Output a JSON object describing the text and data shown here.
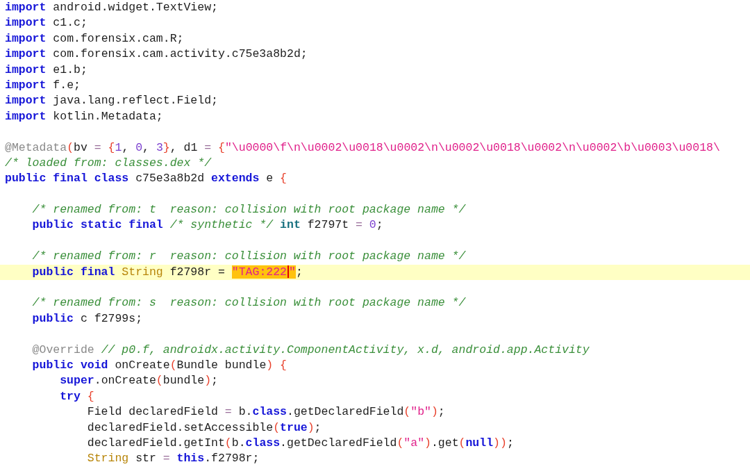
{
  "code_lines": [
    {
      "highlighted": false,
      "tokens": [
        {
          "kind": "keyword",
          "text": "import"
        },
        {
          "kind": "plain",
          "text": " android.widget.TextView;"
        }
      ]
    },
    {
      "highlighted": false,
      "tokens": [
        {
          "kind": "keyword",
          "text": "import"
        },
        {
          "kind": "plain",
          "text": " c1.c;"
        }
      ]
    },
    {
      "highlighted": false,
      "tokens": [
        {
          "kind": "keyword",
          "text": "import"
        },
        {
          "kind": "plain",
          "text": " com.forensix.cam.R;"
        }
      ]
    },
    {
      "highlighted": false,
      "tokens": [
        {
          "kind": "keyword",
          "text": "import"
        },
        {
          "kind": "plain",
          "text": " com.forensix.cam.activity.c75e3a8b2d;"
        }
      ]
    },
    {
      "highlighted": false,
      "tokens": [
        {
          "kind": "keyword",
          "text": "import"
        },
        {
          "kind": "plain",
          "text": " e1.b;"
        }
      ]
    },
    {
      "highlighted": false,
      "tokens": [
        {
          "kind": "keyword",
          "text": "import"
        },
        {
          "kind": "plain",
          "text": " f.e;"
        }
      ]
    },
    {
      "highlighted": false,
      "tokens": [
        {
          "kind": "keyword",
          "text": "import"
        },
        {
          "kind": "plain",
          "text": " java.lang.reflect.Field;"
        }
      ]
    },
    {
      "highlighted": false,
      "tokens": [
        {
          "kind": "keyword",
          "text": "import"
        },
        {
          "kind": "plain",
          "text": " kotlin.Metadata;"
        }
      ]
    },
    {
      "highlighted": false
    },
    {
      "highlighted": false,
      "tokens": [
        {
          "kind": "annotation",
          "text": "@Metadata"
        },
        {
          "kind": "punct",
          "text": "("
        },
        {
          "kind": "plain",
          "text": "bv "
        },
        {
          "kind": "operator",
          "text": "="
        },
        {
          "kind": "punct",
          "text": " {"
        },
        {
          "kind": "number",
          "text": "1"
        },
        {
          "kind": "plain",
          "text": ", "
        },
        {
          "kind": "number",
          "text": "0"
        },
        {
          "kind": "plain",
          "text": ", "
        },
        {
          "kind": "number",
          "text": "3"
        },
        {
          "kind": "punct",
          "text": "}"
        },
        {
          "kind": "plain",
          "text": ", d1 "
        },
        {
          "kind": "operator",
          "text": "="
        },
        {
          "kind": "punct",
          "text": " {"
        },
        {
          "kind": "string",
          "text": "\"\\u0000\\f\\n\\u0002\\u0018\\u0002\\n\\u0002\\u0018\\u0002\\n\\u0002\\b\\u0003\\u0018\\"
        }
      ]
    },
    {
      "highlighted": false,
      "tokens": [
        {
          "kind": "comment",
          "text": "/* loaded from: classes.dex */"
        }
      ]
    },
    {
      "highlighted": false,
      "tokens": [
        {
          "kind": "keyword",
          "text": "public final class"
        },
        {
          "kind": "plain",
          "text": " c75e3a8b2d "
        },
        {
          "kind": "keyword",
          "text": "extends"
        },
        {
          "kind": "plain",
          "text": " e "
        },
        {
          "kind": "punct",
          "text": "{"
        }
      ]
    },
    {
      "highlighted": false
    },
    {
      "highlighted": false,
      "tokens": [
        {
          "kind": "comment",
          "text": "    /* renamed from: t  reason: collision with root package name */"
        }
      ]
    },
    {
      "highlighted": false,
      "tokens": [
        {
          "kind": "keyword",
          "text": "    public static final"
        },
        {
          "kind": "comment",
          "text": " /* synthetic */"
        },
        {
          "kind": "primitive",
          "text": " int"
        },
        {
          "kind": "plain",
          "text": " f2797t "
        },
        {
          "kind": "operator",
          "text": "="
        },
        {
          "kind": "number",
          "text": " 0"
        },
        {
          "kind": "plain",
          "text": ";"
        }
      ]
    },
    {
      "highlighted": false
    },
    {
      "highlighted": false,
      "tokens": [
        {
          "kind": "comment",
          "text": "    /* renamed from: r  reason: collision with root package name */"
        }
      ]
    },
    {
      "highlighted": true,
      "tokens": [
        {
          "kind": "keyword",
          "text": "    public final"
        },
        {
          "kind": "type",
          "text": " String"
        },
        {
          "kind": "plain",
          "text": " f2798r = "
        },
        {
          "kind": "string",
          "text": "\"TAG:222",
          "match": true,
          "caret": true
        },
        {
          "kind": "string",
          "text": "\"",
          "match": true
        },
        {
          "kind": "plain",
          "text": ";"
        }
      ]
    },
    {
      "highlighted": false
    },
    {
      "highlighted": false,
      "tokens": [
        {
          "kind": "comment",
          "text": "    /* renamed from: s  reason: collision with root package name */"
        }
      ]
    },
    {
      "highlighted": false,
      "tokens": [
        {
          "kind": "keyword",
          "text": "    public"
        },
        {
          "kind": "plain",
          "text": " c f2799s;"
        }
      ]
    },
    {
      "highlighted": false
    },
    {
      "highlighted": false,
      "tokens": [
        {
          "kind": "annotation",
          "text": "    @Override"
        },
        {
          "kind": "comment",
          "text": " // p0.f, androidx.activity.ComponentActivity, x.d, android.app.Activity"
        }
      ]
    },
    {
      "highlighted": false,
      "tokens": [
        {
          "kind": "keyword",
          "text": "    public void"
        },
        {
          "kind": "plain",
          "text": " onCreate"
        },
        {
          "kind": "punct",
          "text": "("
        },
        {
          "kind": "plain",
          "text": "Bundle bundle"
        },
        {
          "kind": "punct",
          "text": ") {"
        }
      ]
    },
    {
      "highlighted": false,
      "tokens": [
        {
          "kind": "keyword",
          "text": "        super"
        },
        {
          "kind": "plain",
          "text": ".onCreate"
        },
        {
          "kind": "punct",
          "text": "("
        },
        {
          "kind": "plain",
          "text": "bundle"
        },
        {
          "kind": "punct",
          "text": ")"
        },
        {
          "kind": "plain",
          "text": ";"
        }
      ]
    },
    {
      "highlighted": false,
      "tokens": [
        {
          "kind": "keyword",
          "text": "        try"
        },
        {
          "kind": "punct",
          "text": " {"
        }
      ]
    },
    {
      "highlighted": false,
      "tokens": [
        {
          "kind": "plain",
          "text": "            Field declaredField "
        },
        {
          "kind": "operator",
          "text": "="
        },
        {
          "kind": "plain",
          "text": " b."
        },
        {
          "kind": "keyword",
          "text": "class"
        },
        {
          "kind": "plain",
          "text": ".getDeclaredField"
        },
        {
          "kind": "punct",
          "text": "("
        },
        {
          "kind": "string",
          "text": "\"b\""
        },
        {
          "kind": "punct",
          "text": ")"
        },
        {
          "kind": "plain",
          "text": ";"
        }
      ]
    },
    {
      "highlighted": false,
      "tokens": [
        {
          "kind": "plain",
          "text": "            declaredField.setAccessible"
        },
        {
          "kind": "punct",
          "text": "("
        },
        {
          "kind": "keyword",
          "text": "true"
        },
        {
          "kind": "punct",
          "text": ")"
        },
        {
          "kind": "plain",
          "text": ";"
        }
      ]
    },
    {
      "highlighted": false,
      "tokens": [
        {
          "kind": "plain",
          "text": "            declaredField.getInt"
        },
        {
          "kind": "punct",
          "text": "("
        },
        {
          "kind": "plain",
          "text": "b."
        },
        {
          "kind": "keyword",
          "text": "class"
        },
        {
          "kind": "plain",
          "text": ".getDeclaredField"
        },
        {
          "kind": "punct",
          "text": "("
        },
        {
          "kind": "string",
          "text": "\"a\""
        },
        {
          "kind": "punct",
          "text": ")"
        },
        {
          "kind": "plain",
          "text": ".get"
        },
        {
          "kind": "punct",
          "text": "("
        },
        {
          "kind": "keyword",
          "text": "null"
        },
        {
          "kind": "punct",
          "text": "))"
        },
        {
          "kind": "plain",
          "text": ";"
        }
      ]
    },
    {
      "highlighted": false,
      "tokens": [
        {
          "kind": "type",
          "text": "            String"
        },
        {
          "kind": "plain",
          "text": " str "
        },
        {
          "kind": "operator",
          "text": "="
        },
        {
          "kind": "keyword",
          "text": " this"
        },
        {
          "kind": "plain",
          "text": ".f2798r;"
        }
      ]
    }
  ]
}
